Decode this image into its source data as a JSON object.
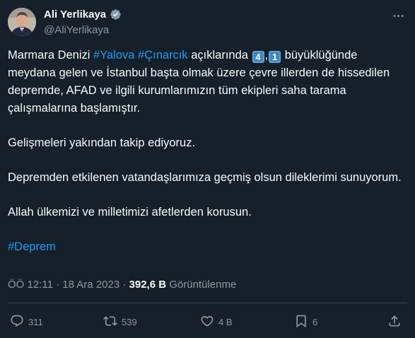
{
  "author": {
    "display_name": "Ali Yerlikaya",
    "handle": "@AliYerlikaya",
    "avatar_icon": "person-avatar",
    "verified_icon": "verified-badge-icon"
  },
  "tweet": {
    "p1_a": "Marmara Denizi ",
    "hashtag_yalova": "#Yalova",
    "space1": " ",
    "hashtag_cinarcik": "#Çınarcık",
    "p1_b": " açıklarında ",
    "keycap_1": "4",
    "comma": ",",
    "keycap_2": "1",
    "p1_c": " büyüklüğünde meydana gelen ve İstanbul başta olmak üzere çevre illerden de hissedilen depremde, AFAD ve ilgili kurumlarımızın tüm ekipleri saha tarama çalışmalarına başlamıştır.",
    "p2": "Gelişmeleri yakından takip ediyoruz.",
    "p3": "Depremden etkilenen vatandaşlarımıza geçmiş olsun dileklerimi sunuyorum.",
    "p4": "Allah ülkemizi ve milletimizi afetlerden korusun.",
    "hashtag_deprem": "#Deprem"
  },
  "meta": {
    "time": "ÖÖ 12:11",
    "separator": " · ",
    "date": "18 Ara 2023",
    "views_count": "392,6 B",
    "views_label": " Görüntülenme"
  },
  "actions": {
    "reply_count": "311",
    "retweet_count": "539",
    "like_count": "4 B",
    "bookmark_count": "6"
  },
  "colors": {
    "background": "#15202b",
    "text": "#f7f9f9",
    "secondary": "#8b98a5",
    "accent": "#1d9bf0"
  }
}
